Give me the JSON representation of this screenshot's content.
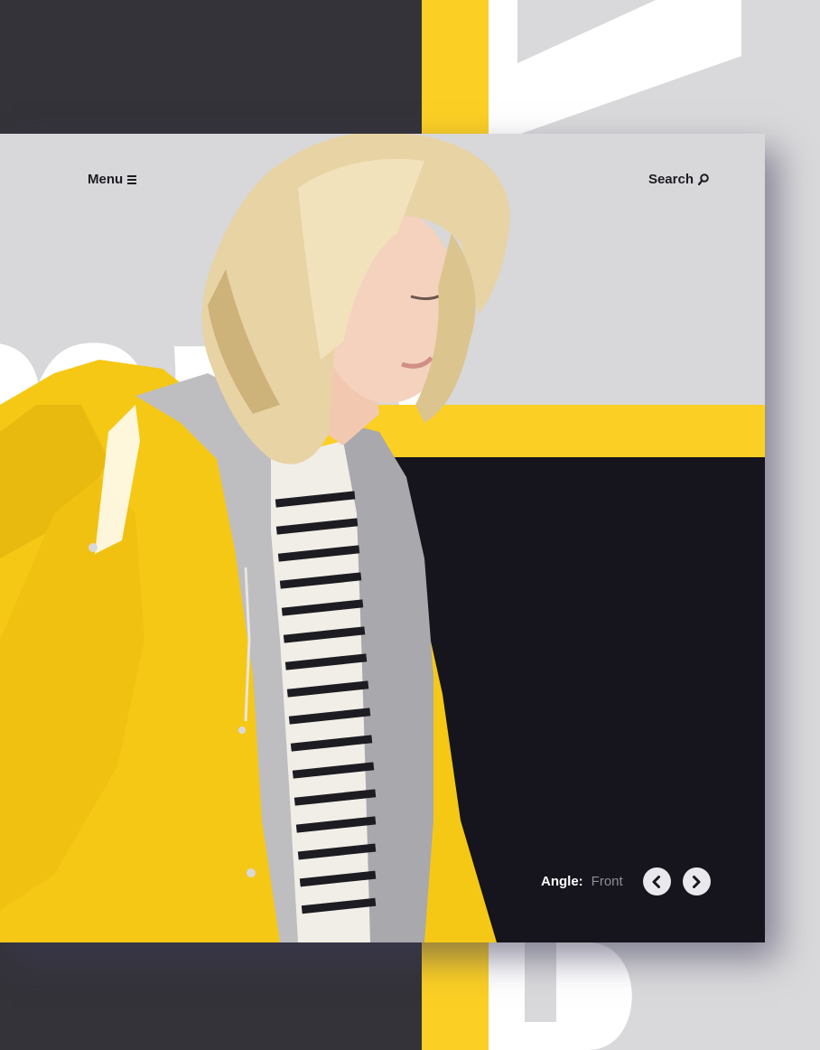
{
  "header": {
    "menu_label": "Menu",
    "search_label": "Search"
  },
  "hero": {
    "background_word": "mre"
  },
  "angle_control": {
    "label": "Angle:",
    "value": "Front"
  },
  "colors": {
    "yellow": "#fbcf24",
    "dark": "#16151d",
    "light_gray": "#d8d7d9",
    "outer_dark": "#34333a"
  },
  "icons": {
    "menu": "menu-icon",
    "search": "search-icon",
    "previous": "chevron-left-icon",
    "next": "chevron-right-icon"
  }
}
